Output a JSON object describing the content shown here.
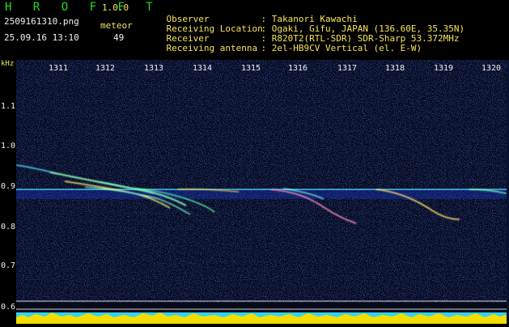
{
  "header": {
    "app_title": "H R O F F T",
    "app_version": "1.0.0",
    "filename": "2509161310.png",
    "datetime": "25.09.16 13:10",
    "meteor_label": "meteor",
    "meteor_count": "49",
    "info": [
      {
        "label": "Observer",
        "value": ": Takanori Kawachi"
      },
      {
        "label": "Receiving Location",
        "value": ": Ogaki, Gifu, JAPAN (136.60E, 35.35N)"
      },
      {
        "label": "Receiver",
        "value": ": R820T2(RTL-SDR) SDR-Sharp 53.372MHz"
      },
      {
        "label": "Receiving antenna",
        "value": ": 2el-HB9CV Vertical (el. E-W)"
      }
    ]
  },
  "axis": {
    "y_unit": "kHz",
    "y_ticks": [
      "1.1",
      "1.0",
      "0.9",
      "0.8",
      "0.7",
      "0.6"
    ],
    "x_ticks": [
      "1311",
      "1312",
      "1313",
      "1314",
      "1315",
      "1316",
      "1317",
      "1318",
      "1319",
      "1320"
    ]
  },
  "colors": {
    "background": "#000000",
    "spectrogram_bg": "#05091a",
    "noise_blue": "#1a38c0",
    "carrier": "#5fe0ff",
    "meteor_trail": "#8fffb0",
    "meteor_core": "#ffd24a",
    "bottom_band": "#f4dd00",
    "header_text": "#f7e35a",
    "title_green": "#22dd22"
  }
}
